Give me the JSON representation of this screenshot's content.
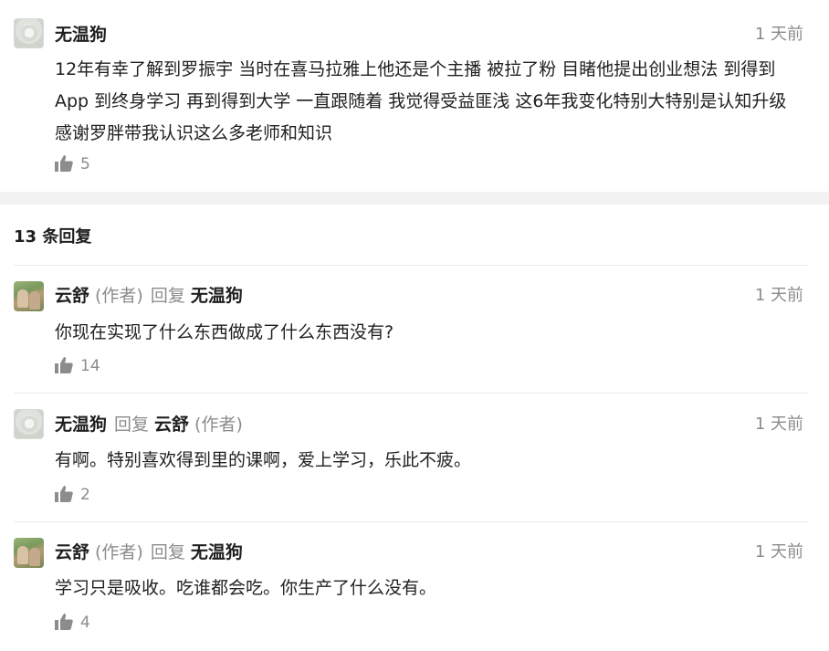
{
  "main_comment": {
    "author": "无温狗",
    "time": "1 天前",
    "content": "12年有幸了解到罗振宇 当时在喜马拉雅上他还是个主播 被拉了粉 目睹他提出创业想法 到得到App 到终身学习 再到得到大学 一直跟随着 我觉得受益匪浅 这6年我变化特别大特别是认知升级 感谢罗胖带我认识这么多老师和知识",
    "likes": "5"
  },
  "replies_header": "13 条回复",
  "reply_word": "回复",
  "author_tag": "(作者)",
  "replies": [
    {
      "author": "云舒",
      "author_tag": "(作者)",
      "reply_to": "无温狗",
      "reply_to_tag": "",
      "time": "1 天前",
      "content": "你现在实现了什么东西做成了什么东西没有?",
      "likes": "14"
    },
    {
      "author": "无温狗",
      "author_tag": "",
      "reply_to": "云舒",
      "reply_to_tag": "(作者)",
      "time": "1 天前",
      "content": "有啊。特别喜欢得到里的课啊，爱上学习，乐此不疲。",
      "likes": "2"
    },
    {
      "author": "云舒",
      "author_tag": "(作者)",
      "reply_to": "无温狗",
      "reply_to_tag": "",
      "time": "1 天前",
      "content": "学习只是吸收。吃谁都会吃。你生产了什么没有。",
      "likes": "4"
    }
  ]
}
